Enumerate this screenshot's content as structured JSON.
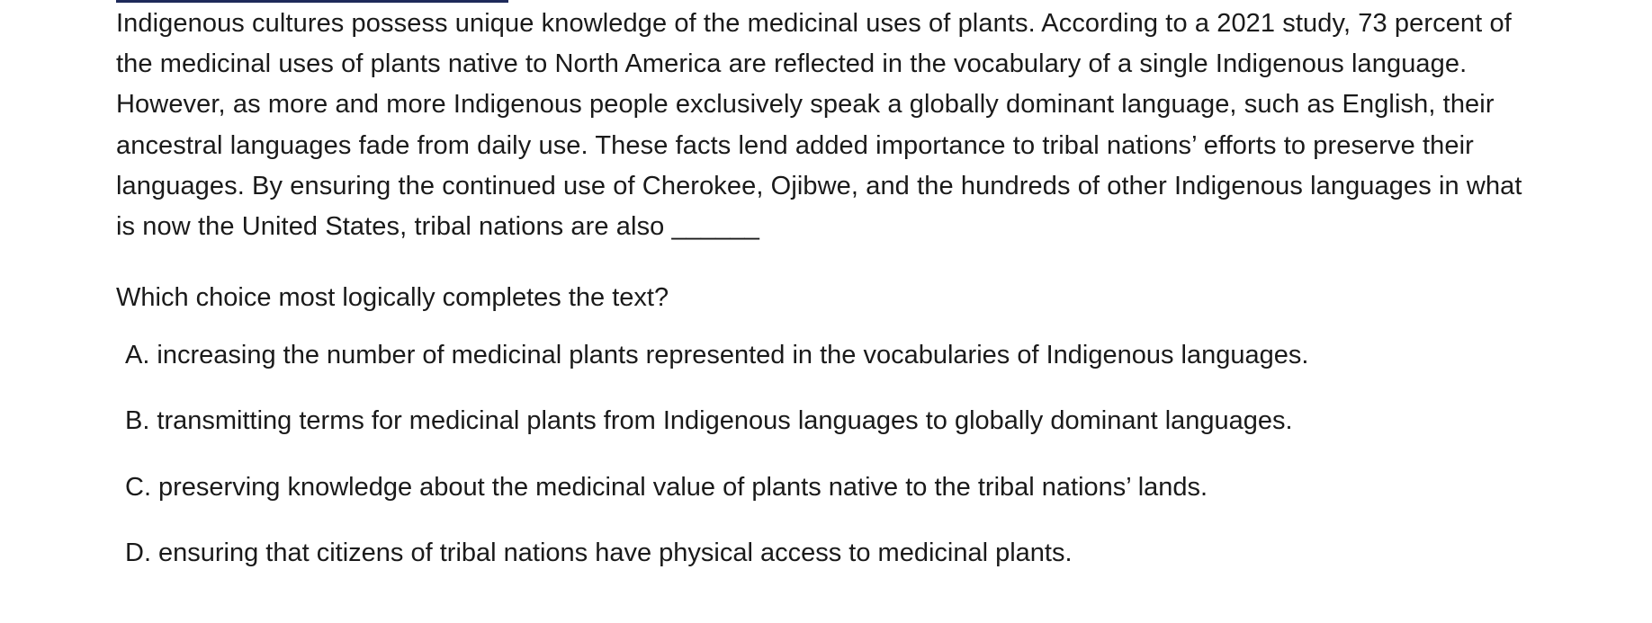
{
  "passage": {
    "text": "Indigenous cultures possess unique knowledge of the medicinal uses of plants. According to a 2021 study, 73 percent of the medicinal uses of plants native to North America are reflected in the vocabulary of a single Indigenous language. However, as more and more Indigenous people exclusively speak a globally dominant language, such as English, their ancestral languages fade from daily use. These facts lend added importance to tribal nations’ efforts to preserve their languages. By ensuring the continued use of Cherokee, Ojibwe, and the hundreds of other Indigenous languages in what is now the United States, tribal nations are also ______"
  },
  "question": {
    "prompt": "Which choice most logically completes the text?"
  },
  "choices": [
    {
      "letter": "A.",
      "text": "increasing the number of medicinal plants represented in the vocabularies of Indigenous languages."
    },
    {
      "letter": "B.",
      "text": "transmitting terms for medicinal plants from Indigenous languages to globally dominant languages."
    },
    {
      "letter": "C.",
      "text": "preserving knowledge about the medicinal value of plants native to the tribal nations’ lands."
    },
    {
      "letter": "D.",
      "text": "ensuring that citizens of tribal nations have physical access to medicinal plants."
    }
  ]
}
